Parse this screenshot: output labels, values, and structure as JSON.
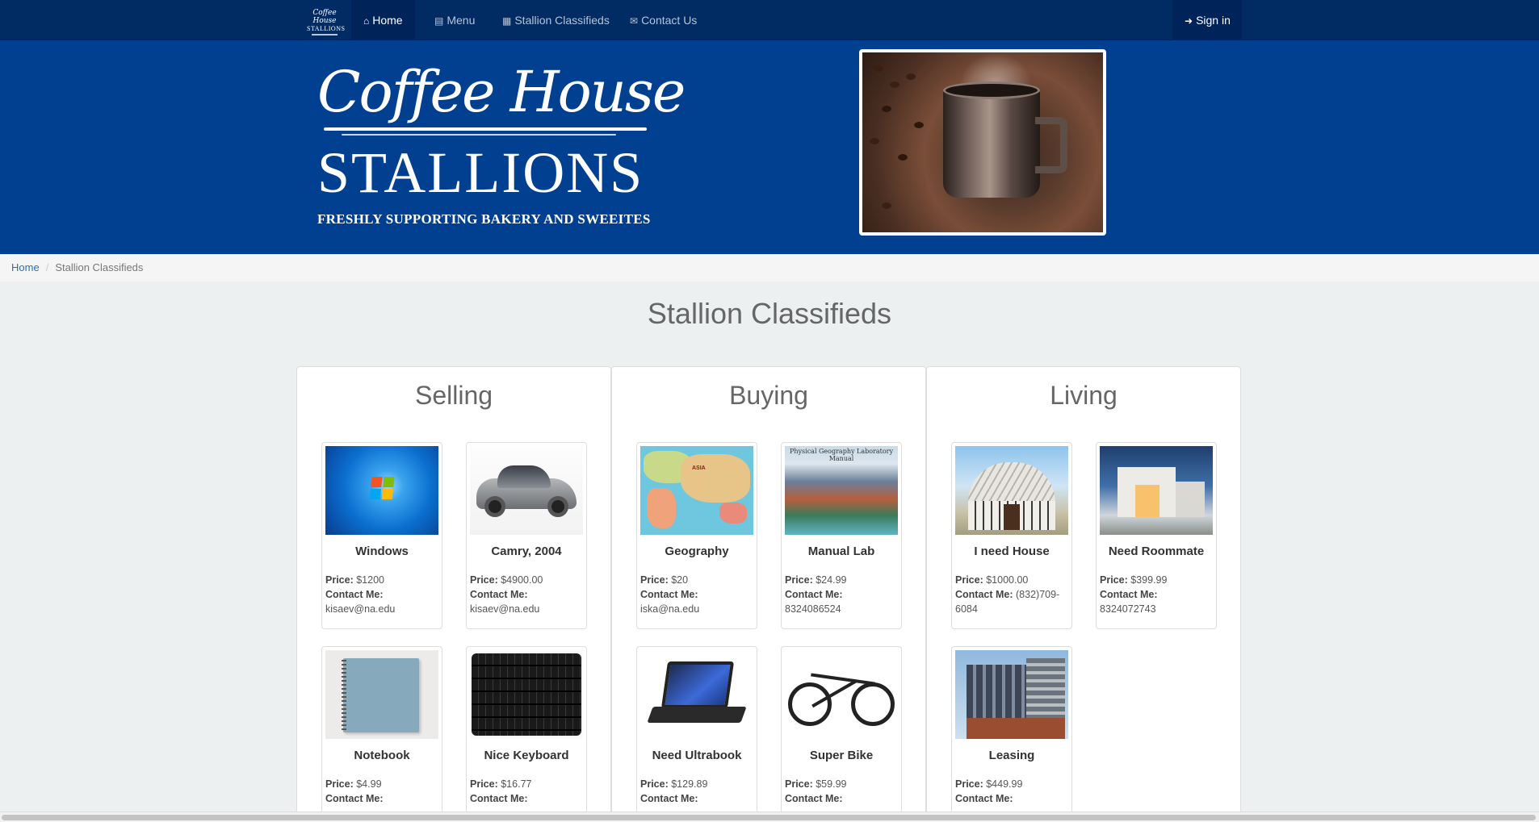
{
  "nav": {
    "brand_line1": "Coffee House",
    "brand_line2": "STALLIONS",
    "items": [
      {
        "label": "Home",
        "icon": "home-icon"
      },
      {
        "label": "Menu",
        "icon": "book-icon"
      },
      {
        "label": "Stallion Classifieds",
        "icon": "newspaper-icon"
      },
      {
        "label": "Contact Us",
        "icon": "envelope-icon"
      }
    ],
    "signin": {
      "label": "Sign in",
      "icon": "sign-in-icon"
    },
    "colors": {
      "navbar": "#012b63",
      "hero": "#014090",
      "active": "#00245a"
    }
  },
  "hero": {
    "script_title": "Coffee House",
    "title": "STALLIONS",
    "tagline": "FRESHLY SUPPORTING BAKERY AND SWEEITES"
  },
  "breadcrumb": {
    "home": "Home",
    "current": "Stallion Classifieds"
  },
  "page_title": "Stallion Classifieds",
  "columns": [
    {
      "title": "Selling",
      "items": [
        {
          "title": "Windows",
          "price_label": "Price:",
          "price": "$1200",
          "contact_label": "Contact Me:",
          "contact": "kisaev@na.edu"
        },
        {
          "title": "Camry, 2004",
          "price_label": "Price:",
          "price": "$4900.00",
          "contact_label": "Contact Me:",
          "contact": "kisaev@na.edu"
        },
        {
          "title": "Notebook",
          "price_label": "Price:",
          "price": "$4.99",
          "contact_label": "Contact Me:",
          "contact": ""
        },
        {
          "title": "Nice Keyboard",
          "price_label": "Price:",
          "price": "$16.77",
          "contact_label": "Contact Me:",
          "contact": ""
        }
      ]
    },
    {
      "title": "Buying",
      "items": [
        {
          "title": "Geography",
          "price_label": "Price:",
          "price": "$20",
          "contact_label": "Contact Me:",
          "contact": "iska@na.edu"
        },
        {
          "title": "Manual Lab",
          "price_label": "Price:",
          "price": "$24.99",
          "contact_label": "Contact Me:",
          "contact": "8324086524"
        },
        {
          "title": "Need Ultrabook",
          "price_label": "Price:",
          "price": "$129.89",
          "contact_label": "Contact Me:",
          "contact": ""
        },
        {
          "title": "Super Bike",
          "price_label": "Price:",
          "price": "$59.99",
          "contact_label": "Contact Me:",
          "contact": ""
        }
      ]
    },
    {
      "title": "Living",
      "items": [
        {
          "title": "I need House",
          "price_label": "Price:",
          "price": "$1000.00",
          "contact_label": "Contact Me:",
          "contact_inline": "(832)709-",
          "contact": "6084"
        },
        {
          "title": "Need Roommate",
          "price_label": "Price:",
          "price": "$399.99",
          "contact_label": "Contact Me:",
          "contact": "8324072743"
        },
        {
          "title": "Leasing",
          "price_label": "Price:",
          "price": "$449.99",
          "contact_label": "Contact Me:",
          "contact": ""
        }
      ]
    }
  ],
  "thumbnail_texts": {
    "manual_lab_header": "Physical Geography Laboratory Manual",
    "map_label": "ASIA"
  }
}
